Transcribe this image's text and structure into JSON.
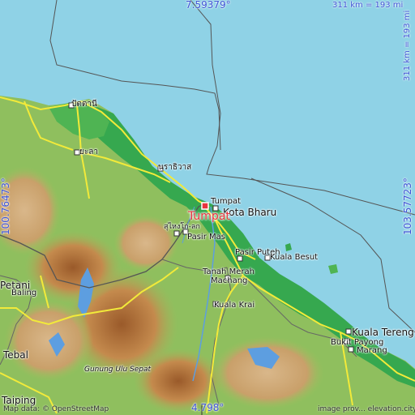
{
  "place": {
    "name": "Tumpat",
    "color": "#e8333d"
  },
  "colors": {
    "sea": "#8fd2e6",
    "lowland": "#36a84f",
    "hills": "#8fbf5e",
    "mountains": "#c48a4d",
    "roads": "#f2ea3a",
    "borders": "#555555"
  },
  "coordinates": {
    "top": "7.59379°",
    "bottom": "4.798°",
    "left": "100.76473°",
    "right": "103.57723°"
  },
  "scale": {
    "horizontal": "311 km = 193 mi",
    "vertical": "311 km = 193 mi"
  },
  "labels": {
    "pattani": "ปัตตานี",
    "yala": "ยะลา",
    "narathiwat": "นราธิวาส",
    "sungai_kolok": "สุไหงโก-ลก",
    "tumpat": "Tumpat",
    "kota_bharu": "Kota Bharu",
    "pasir_mas": "Pasir Mas",
    "pasir_puteh": "Pasir Puteh",
    "kuala_besut": "Kuala Besut",
    "tanah_merah": "Tanah Merah",
    "machang": "Machang",
    "kuala_krai": "Kuala Krai",
    "kuala_terengganu": "Kuala Tereng",
    "bukit_payong": "Bukit Payong",
    "marang": "Marang",
    "baling": "Baling",
    "petani": "Petani",
    "tebal": "Tebal",
    "taiping": "Taiping",
    "gunung_ulu_sepat": "Gunung Ulu Sepat"
  },
  "credits": {
    "left": "Map data: © OpenStreetMap",
    "right": "image prov... elevation.city"
  },
  "icons": {
    "city_marker": "square-dot-icon",
    "highlight_marker": "red-square-icon",
    "island": "island-icon"
  }
}
